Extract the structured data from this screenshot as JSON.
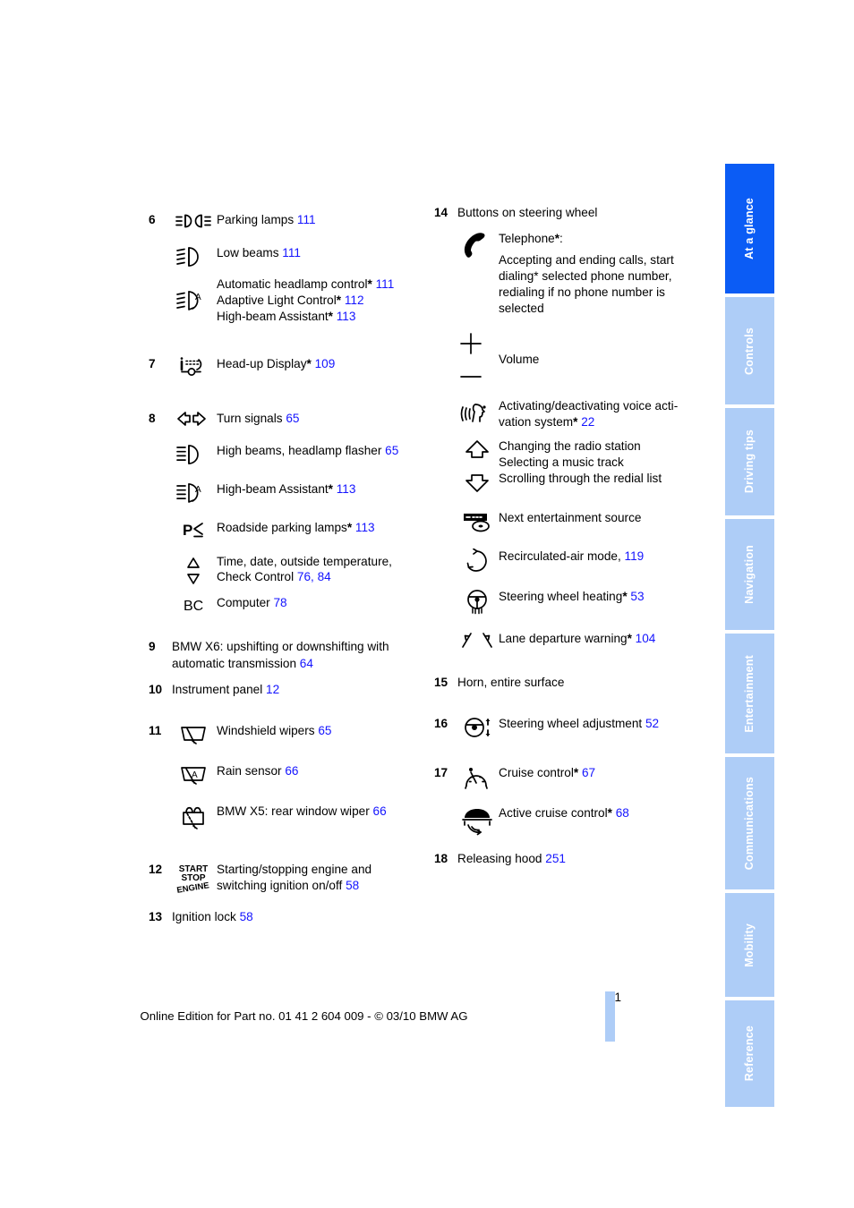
{
  "page": {
    "number": "11",
    "footer": "Online Edition for Part no. 01 41 2 604 009 - © 03/10 BMW AG",
    "accent_blue": "#1414ff",
    "tab_active_blue": "#0b5cf5",
    "tab_blue": "#aecdf7"
  },
  "tabs": [
    {
      "label": "At a glance",
      "active": true
    },
    {
      "label": "Controls",
      "active": false
    },
    {
      "label": "Driving tips",
      "active": false
    },
    {
      "label": "Navigation",
      "active": false
    },
    {
      "label": "Entertainment",
      "active": false
    },
    {
      "label": "Communications",
      "active": false
    },
    {
      "label": "Mobility",
      "active": false
    },
    {
      "label": "Reference",
      "active": false
    }
  ],
  "left_column": {
    "item6": {
      "num": "6",
      "rows": [
        {
          "icon": "parking-lamps-icon",
          "text": "Parking lamps",
          "page": "111"
        },
        {
          "icon": "low-beams-icon",
          "text": "Low beams",
          "page": "111"
        },
        {
          "icon": "adaptive-light-control-icon",
          "lines": [
            {
              "text": "Automatic headlamp control",
              "star": "*",
              "page": "111"
            },
            {
              "text": "Adaptive Light Control",
              "star": "*",
              "page": "112"
            },
            {
              "text": "High-beam Assistant",
              "star": "*",
              "page": "113"
            }
          ]
        }
      ]
    },
    "item7": {
      "num": "7",
      "icon": "head-up-display-icon",
      "text": "Head-up Display",
      "star": "*",
      "page": "109"
    },
    "item8": {
      "num": "8",
      "rows": [
        {
          "icon": "turn-signals-icon",
          "text": "Turn signals",
          "page": "65"
        },
        {
          "icon": "high-beams-icon",
          "text": "High beams, headlamp flasher",
          "page": "65"
        },
        {
          "icon": "high-beam-assistant-icon",
          "text": "High-beam Assistant",
          "star": "*",
          "page": "113"
        },
        {
          "icon": "roadside-parking-lamps-icon",
          "text": "Roadside parking lamps",
          "star": "*",
          "page": "113"
        },
        {
          "icon": "up-down-triangles-icon",
          "line1": "Time, date, outside temperature,",
          "line2": "Check Control",
          "page": "76",
          "page2": "84"
        },
        {
          "icon": "bc-computer-icon",
          "text": "Computer",
          "page": "78"
        }
      ]
    },
    "item9": {
      "num": "9",
      "line1": "BMW X6: upshifting or downshifting with",
      "line2": "automatic transmission",
      "page": "64"
    },
    "item10": {
      "num": "10",
      "text": "Instrument panel",
      "page": "12"
    },
    "item11": {
      "num": "11",
      "rows": [
        {
          "icon": "windshield-wipers-icon",
          "text": "Windshield wipers",
          "page": "65"
        },
        {
          "icon": "rain-sensor-icon",
          "text": "Rain sensor",
          "page": "66"
        },
        {
          "icon": "rear-window-wiper-icon",
          "text": "BMW X5: rear window wiper",
          "page": "66"
        }
      ]
    },
    "item12": {
      "num": "12",
      "icon": "start-stop-engine-icon",
      "icon_text": {
        "line1": "START",
        "line2": "STOP",
        "line3": "ENGINE"
      },
      "line1": "Starting/stopping engine and",
      "line2": "switching ignition on/off",
      "page": "58"
    },
    "item13": {
      "num": "13",
      "text": "Ignition lock",
      "page": "58"
    }
  },
  "right_column": {
    "item14": {
      "num": "14",
      "heading": "Buttons on steering wheel",
      "phone": {
        "icon": "telephone-icon",
        "title": "Telephone",
        "star": "*",
        "colon": ":",
        "body_lines": [
          "Accepting and ending calls, start",
          "dialing* selected phone number,",
          "redialing if no phone number is",
          "selected"
        ]
      },
      "volume": {
        "plus_icon": "plus-icon",
        "minus_icon": "minus-icon",
        "text": "Volume"
      },
      "voice": {
        "icon": "voice-activation-icon",
        "line1": "Activating/deactivating voice acti-",
        "line2": "vation system",
        "star": "*",
        "page": "22"
      },
      "arrows": {
        "up_icon": "arrow-up-icon",
        "down_icon": "arrow-down-icon",
        "lines": [
          "Changing the radio station",
          "Selecting a music track",
          "Scrolling through the redial list"
        ]
      },
      "entertainment": {
        "icon": "entertainment-source-icon",
        "text": "Next entertainment source"
      },
      "recirc": {
        "icon": "recirculated-air-icon",
        "text": "Recirculated-air mode,",
        "page": "119"
      },
      "wheel_heating": {
        "icon": "steering-wheel-heating-icon",
        "text": "Steering wheel heating",
        "star": "*",
        "page": "53"
      },
      "lane": {
        "icon": "lane-departure-warning-icon",
        "text": "Lane departure warning",
        "star": "*",
        "page": "104"
      }
    },
    "item15": {
      "num": "15",
      "text": "Horn, entire surface"
    },
    "item16": {
      "num": "16",
      "icon": "steering-wheel-adjustment-icon",
      "text": "Steering wheel adjustment",
      "page": "52"
    },
    "item17": {
      "num": "17",
      "rows": [
        {
          "icon": "cruise-control-icon",
          "text": "Cruise control",
          "star": "*",
          "page": "67"
        },
        {
          "icon": "active-cruise-control-icon",
          "text": "Active cruise control",
          "star": "*",
          "page": "68"
        }
      ]
    },
    "item18": {
      "num": "18",
      "text": "Releasing hood",
      "page": "251"
    }
  }
}
